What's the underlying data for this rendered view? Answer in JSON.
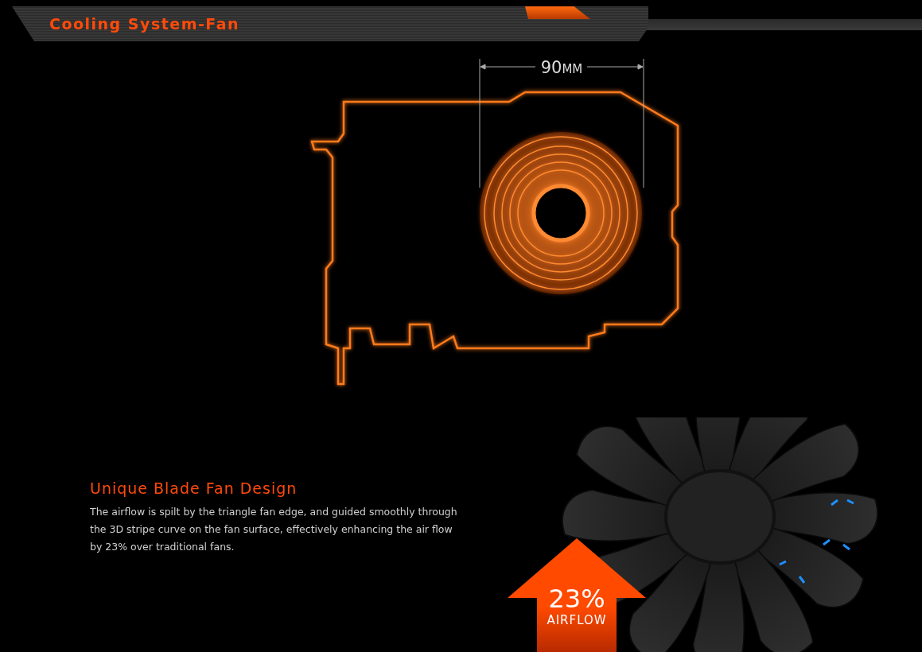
{
  "header": {
    "title": "Cooling System-Fan"
  },
  "diagram": {
    "dimension": {
      "value": "90",
      "unit": "MM"
    }
  },
  "feature": {
    "title": "Unique Blade Fan Design",
    "body": "The airflow is spilt by the triangle fan edge, and guided smoothly through the 3D stripe curve on the fan surface, effectively enhancing the air flow by 23% over traditional fans."
  },
  "airflow_badge": {
    "value": "23%",
    "label": "AIRFLOW"
  }
}
